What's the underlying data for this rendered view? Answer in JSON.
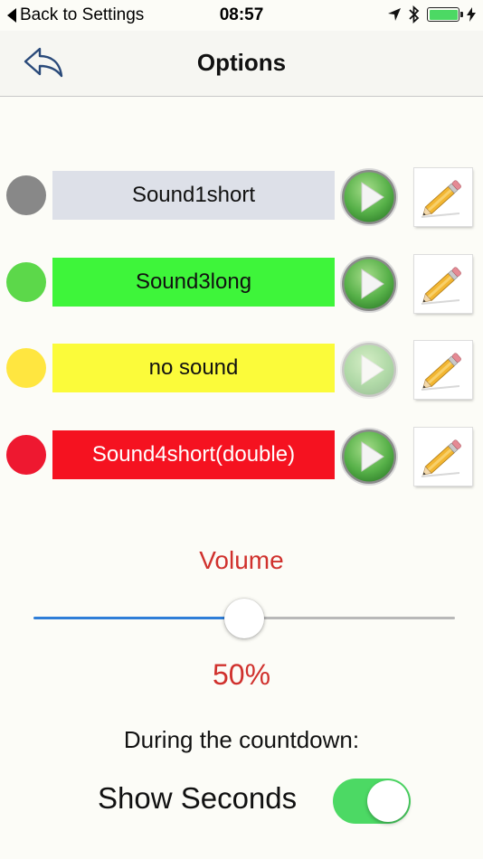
{
  "status_bar": {
    "back_label": "Back to Settings",
    "time": "08:57",
    "icons": [
      "location-arrow-icon",
      "bluetooth-icon",
      "battery-icon",
      "charging-bolt-icon"
    ],
    "battery_level": 1.0,
    "battery_color": "#4cd964"
  },
  "nav": {
    "title": "Options",
    "back_icon": "back-arrow-icon"
  },
  "sounds": [
    {
      "label": "Sound1short",
      "dot_color": "#888888",
      "bg_color": "#dde0e8",
      "text_color": "#111111",
      "play_enabled": true
    },
    {
      "label": "Sound3long",
      "dot_color": "#5cd84a",
      "bg_color": "#3ef53a",
      "text_color": "#111111",
      "play_enabled": true
    },
    {
      "label": "no sound",
      "dot_color": "#ffe640",
      "bg_color": "#fbfb3a",
      "text_color": "#111111",
      "play_enabled": false
    },
    {
      "label": "Sound4short(double)",
      "dot_color": "#ee1830",
      "bg_color": "#f51220",
      "text_color": "#ffffff",
      "play_enabled": true
    }
  ],
  "volume": {
    "label": "Volume",
    "value_text": "50%",
    "value": 0.5,
    "accent_color": "#d0312d",
    "track_min_color": "#2f7ed8"
  },
  "countdown": {
    "label": "During the countdown:",
    "show_seconds_label": "Show Seconds",
    "show_seconds_on": true,
    "toggle_color": "#4cd964"
  }
}
